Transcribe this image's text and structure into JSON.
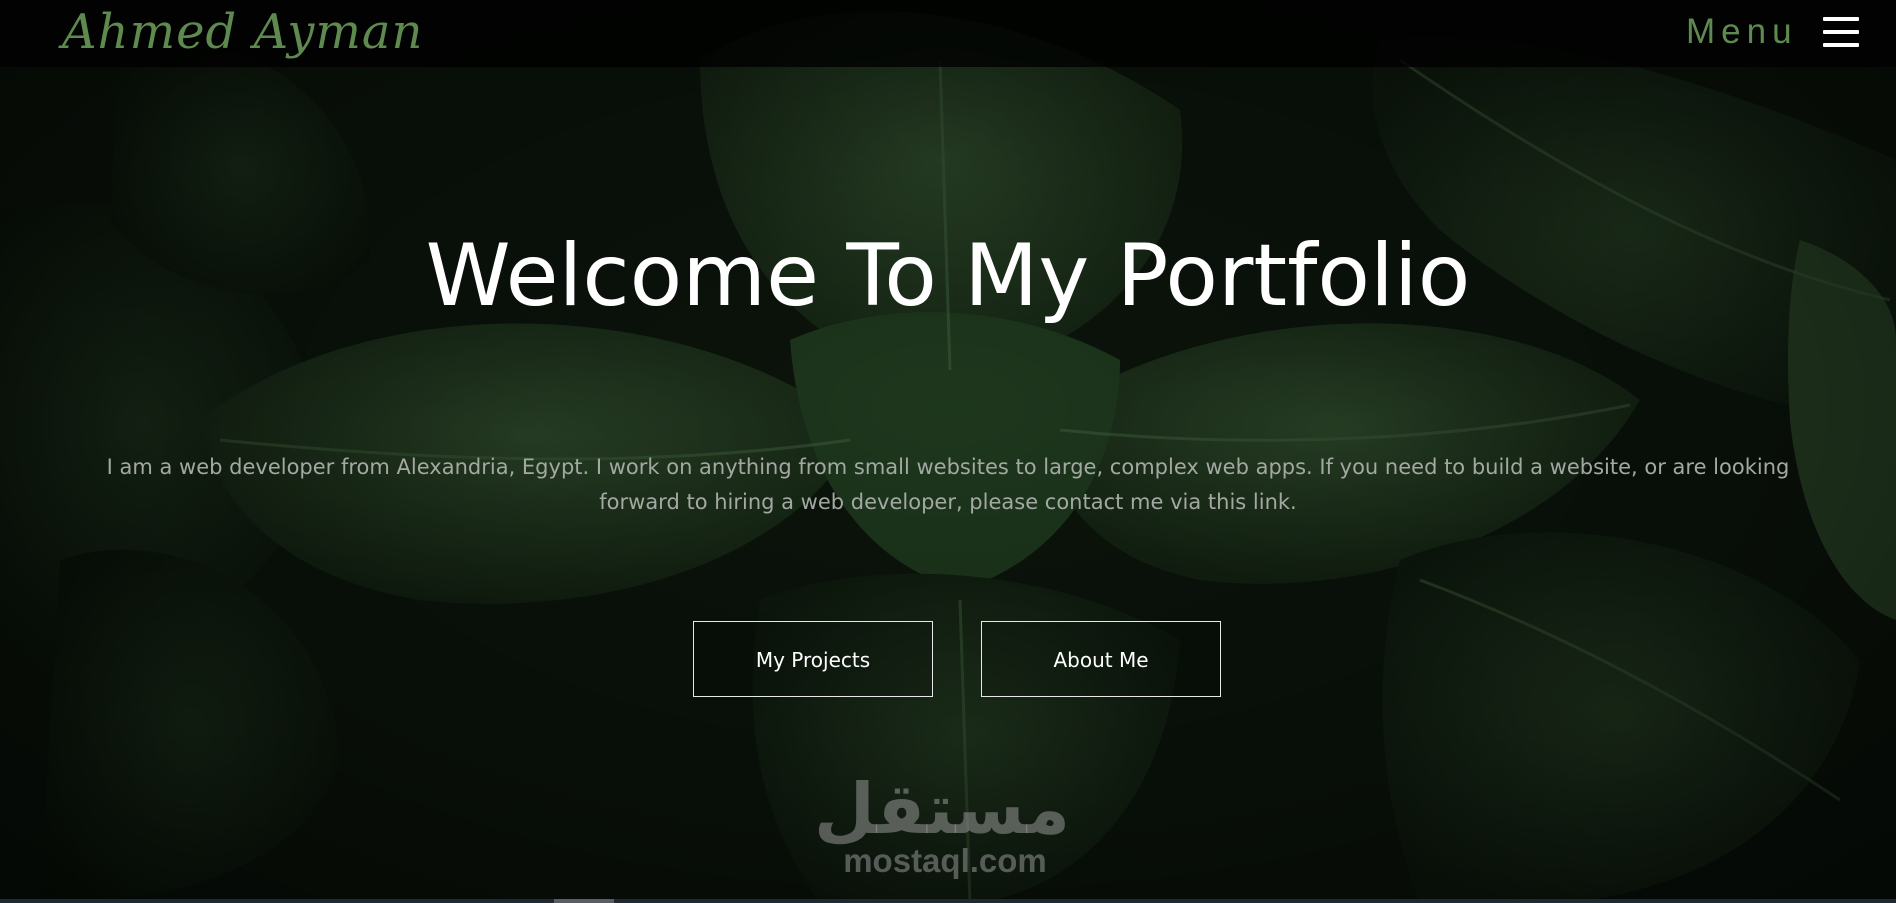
{
  "header": {
    "brand": "Ahmed Ayman",
    "menu_label": "Menu"
  },
  "hero": {
    "title": "Welcome To My Portfolio",
    "description": "I am a web developer from Alexandria, Egypt. I work on anything from small websites to large, complex web apps. If you need to build a website, or are looking forward to hiring a web developer, please contact me via this link.",
    "buttons": {
      "projects": "My Projects",
      "about": "About Me"
    }
  },
  "watermark": {
    "arabic": "مستقل",
    "latin": "mostaql.com"
  },
  "colors": {
    "accent": "#5f8a4f",
    "background": "#0b130b",
    "text": "#ffffff",
    "muted_text": "#a3a8a2"
  },
  "icons": {
    "menu": "hamburger-icon"
  }
}
